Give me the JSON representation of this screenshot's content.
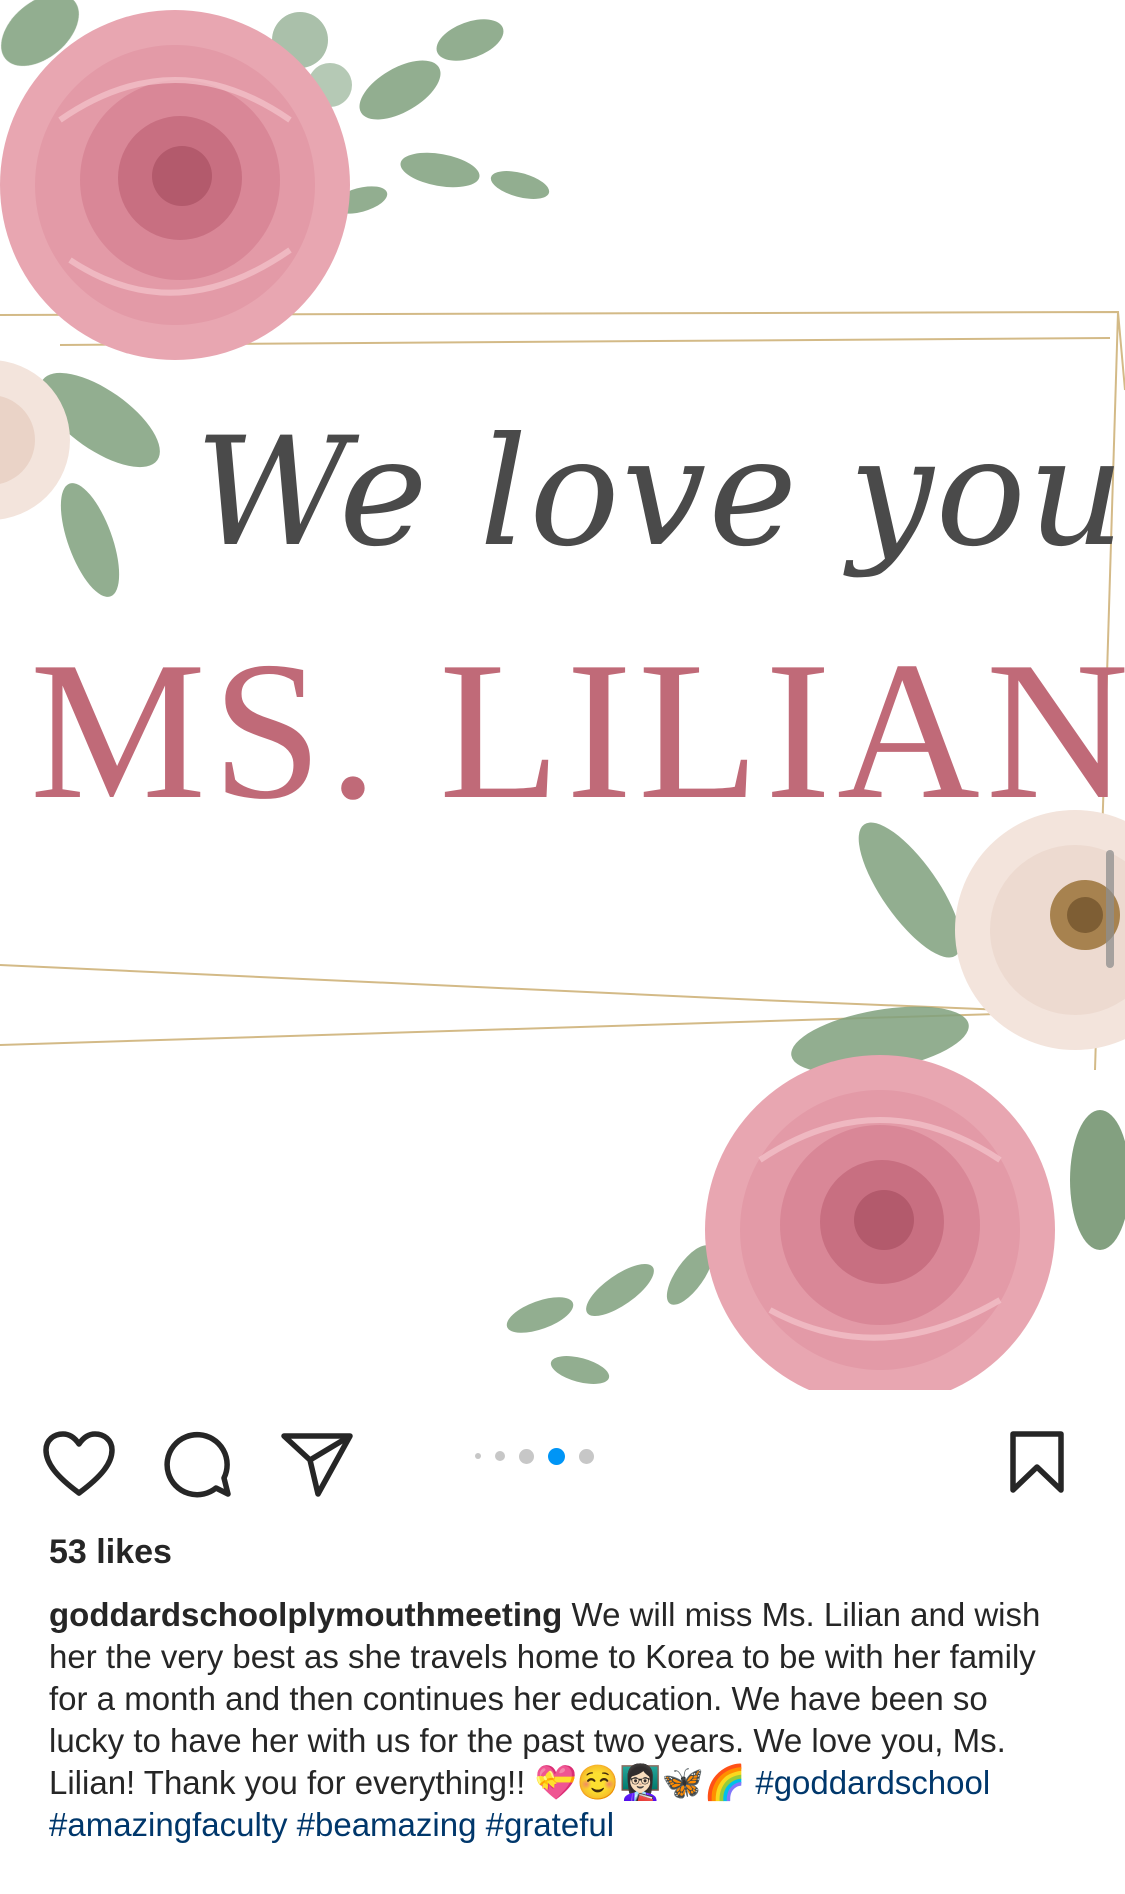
{
  "post": {
    "image": {
      "script_text": "We love you",
      "name_text": "MS. LILIAN",
      "colors": {
        "script": "#4a4a4a",
        "name": "#c06a78",
        "rose": "#e8a6b1",
        "rose_dark": "#c86f81",
        "cream_rose": "#f3e4dc",
        "leaf": "#7fa07c",
        "gold_frame": "#c9a96a"
      }
    },
    "actions": {
      "like_icon": "heart-icon",
      "comment_icon": "comment-icon",
      "share_icon": "paper-plane-icon",
      "save_icon": "bookmark-icon"
    },
    "carousel": {
      "total_dots": 5,
      "active_index": 3,
      "active_color": "#0095f6"
    },
    "likes_text": "53 likes",
    "caption": {
      "username": "goddardschoolplymouthmeeting",
      "text": " We will miss Ms. Lilian and wish her the very best as she travels home to Korea to be with her family for a month and then continues her education. We have been so lucky to have her with us for the past two years. We love you, Ms. Lilian! Thank you for everything!! ",
      "emojis": "💝☺️👩🏻‍🏫🦋🌈",
      "hashtags": [
        "#goddardschool",
        "#amazingfaculty",
        "#beamazing",
        "#grateful"
      ]
    }
  }
}
